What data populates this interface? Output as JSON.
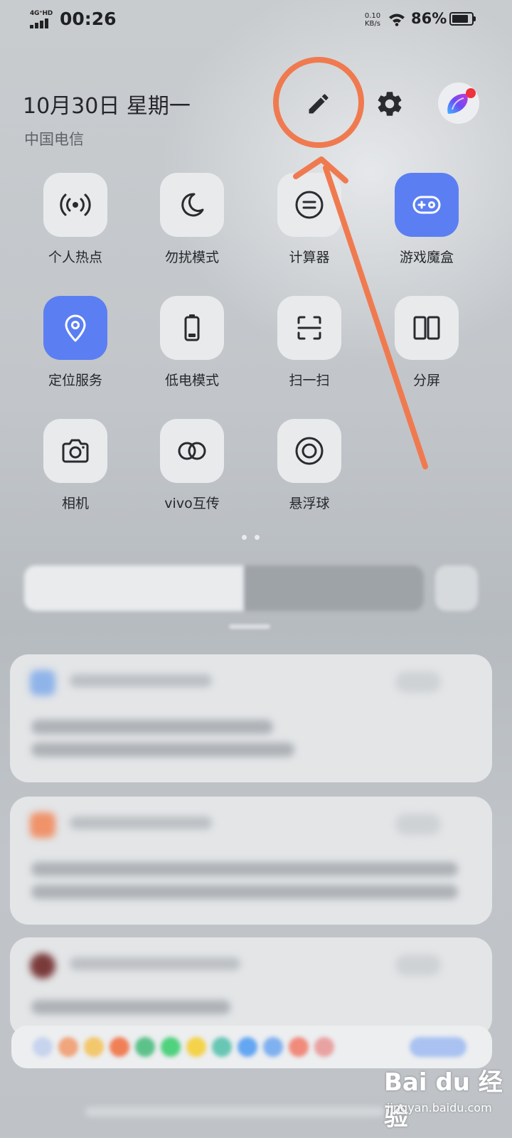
{
  "status_bar": {
    "network": "4G⁺HD",
    "time": "00:26",
    "speed_value": "0.10",
    "speed_unit": "KB/s",
    "battery": "86%",
    "battery_level": 0.86
  },
  "header": {
    "date": "10月30日 星期一",
    "carrier": "中国电信"
  },
  "icons": {
    "edit": "pencil-icon",
    "settings": "gear-icon",
    "assistant": "jovi-avatar-icon"
  },
  "tiles": [
    {
      "label": "个人热点",
      "icon": "hotspot-icon",
      "active": false
    },
    {
      "label": "勿扰模式",
      "icon": "moon-icon",
      "active": false
    },
    {
      "label": "计算器",
      "icon": "calculator-icon",
      "active": false
    },
    {
      "label": "游戏魔盒",
      "icon": "gamepad-icon",
      "active": true
    },
    {
      "label": "定位服务",
      "icon": "location-pin-icon",
      "active": true
    },
    {
      "label": "低电模式",
      "icon": "battery-low-icon",
      "active": false
    },
    {
      "label": "扫一扫",
      "icon": "scan-icon",
      "active": false
    },
    {
      "label": "分屏",
      "icon": "split-screen-icon",
      "active": false
    },
    {
      "label": "相机",
      "icon": "camera-icon",
      "active": false
    },
    {
      "label": "vivo互传",
      "icon": "link-rings-icon",
      "active": false
    },
    {
      "label": "悬浮球",
      "icon": "floating-ball-icon",
      "active": false
    }
  ],
  "brightness": {
    "level": 0.55
  },
  "watermark": {
    "logo": "Bai du 经验",
    "url": "jingyan.baidu.com"
  },
  "colors": {
    "accent_blue": "#5b7ff2",
    "annotation_orange": "#f07a4f",
    "tile_bg": "#e8eaec",
    "text_dark": "#26282b"
  }
}
